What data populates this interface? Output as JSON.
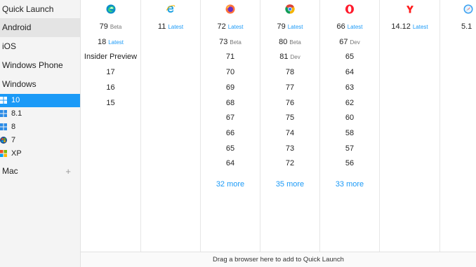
{
  "sidebar": {
    "quick_launch": "Quick Launch",
    "android": "Android",
    "ios": "iOS",
    "windows_phone": "Windows Phone",
    "windows": "Windows",
    "win10": "10",
    "win81": "8.1",
    "win8": "8",
    "win7": "7",
    "winxp": "XP",
    "mac": "Mac",
    "mac_expand": "+"
  },
  "browsers": {
    "edge": {
      "versions": [
        {
          "v": "79",
          "tag": "Beta"
        },
        {
          "v": "18",
          "tag": "Latest"
        },
        {
          "v": "Insider Preview"
        },
        {
          "v": "17"
        },
        {
          "v": "16"
        },
        {
          "v": "15"
        }
      ]
    },
    "ie": {
      "versions": [
        {
          "v": "11",
          "tag": "Latest"
        }
      ]
    },
    "firefox": {
      "versions": [
        {
          "v": "72",
          "tag": "Latest"
        },
        {
          "v": "73",
          "tag": "Beta"
        },
        {
          "v": "71"
        },
        {
          "v": "70"
        },
        {
          "v": "69"
        },
        {
          "v": "68"
        },
        {
          "v": "67"
        },
        {
          "v": "66"
        },
        {
          "v": "65"
        },
        {
          "v": "64"
        }
      ],
      "more": "32 more"
    },
    "chrome": {
      "versions": [
        {
          "v": "79",
          "tag": "Latest"
        },
        {
          "v": "80",
          "tag": "Beta"
        },
        {
          "v": "81",
          "tag": "Dev"
        },
        {
          "v": "78"
        },
        {
          "v": "77"
        },
        {
          "v": "76"
        },
        {
          "v": "75"
        },
        {
          "v": "74"
        },
        {
          "v": "73"
        },
        {
          "v": "72"
        }
      ],
      "more": "35 more"
    },
    "opera": {
      "versions": [
        {
          "v": "66",
          "tag": "Latest"
        },
        {
          "v": "67",
          "tag": "Dev"
        },
        {
          "v": "65"
        },
        {
          "v": "64"
        },
        {
          "v": "63"
        },
        {
          "v": "62"
        },
        {
          "v": "60"
        },
        {
          "v": "58"
        },
        {
          "v": "57"
        },
        {
          "v": "56"
        }
      ],
      "more": "33 more"
    },
    "yandex": {
      "versions": [
        {
          "v": "14.12",
          "tag": "Latest"
        }
      ]
    },
    "safari": {
      "versions": [
        {
          "v": "5.1"
        }
      ]
    }
  },
  "footer": "Drag a browser here to add to Quick Launch",
  "colors": {
    "accent": "#1b9af7",
    "selected_bg": "#1b9af7",
    "sidebar_bg": "#f4f4f4"
  }
}
